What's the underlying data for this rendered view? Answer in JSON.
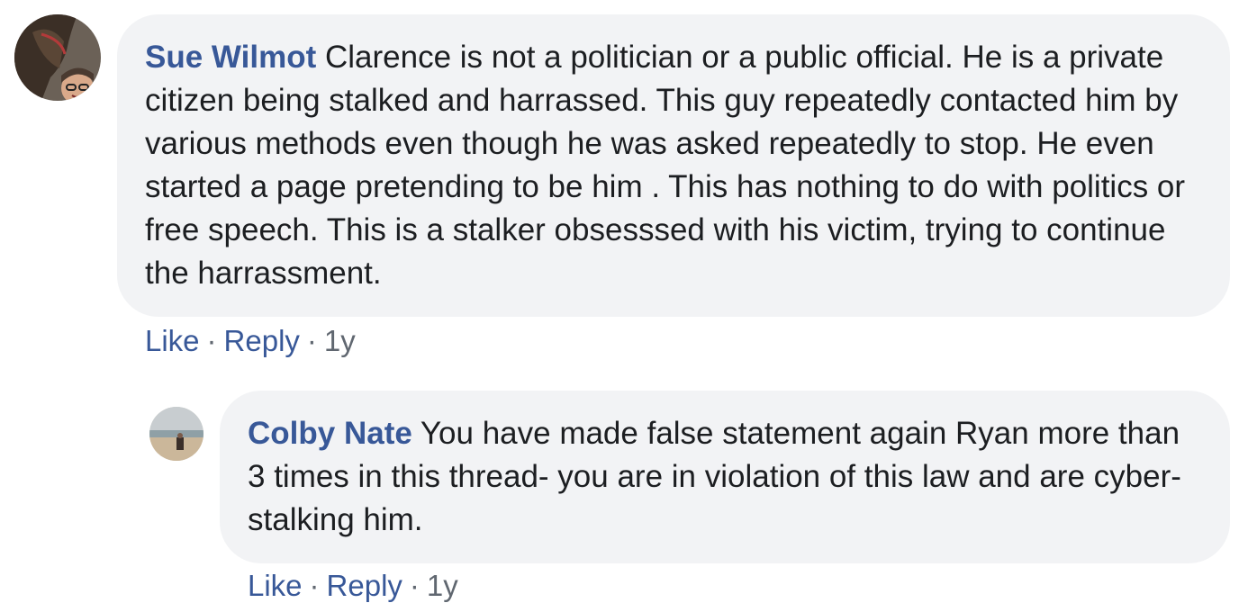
{
  "comments": [
    {
      "author": "Sue Wilmot",
      "text": "Clarence is not a politician or a public official. He is a private citizen being stalked and harrassed. This guy repeatedly contacted him by various methods even though he was asked repeatedly to stop. He even started a page pretending to be him . This has nothing to do with politics or free speech. This is a stalker obsesssed with his victim, trying to continue the harrassment.",
      "like_label": "Like",
      "reply_label": "Reply",
      "separator": "·",
      "timestamp": "1y"
    },
    {
      "author": "Colby Nate",
      "text": "You have made false statement again Ryan more than 3 times in this thread- you are in violation of this law and are cyber-stalking him.",
      "like_label": "Like",
      "reply_label": "Reply",
      "separator": "·",
      "timestamp": "1y"
    }
  ],
  "colors": {
    "link": "#385898",
    "bubble": "#f2f3f5",
    "text": "#1c1e21",
    "meta": "#606770"
  }
}
